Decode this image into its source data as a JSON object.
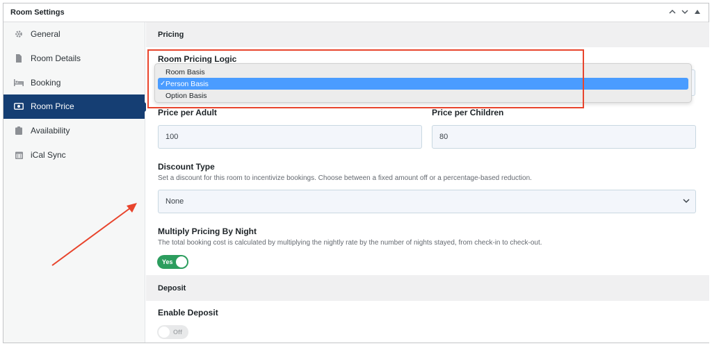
{
  "panel": {
    "title": "Room Settings",
    "collapse_up": "⌃",
    "collapse_down": "⌄",
    "move": "▴"
  },
  "sidebar": {
    "items": [
      {
        "label": "General",
        "icon": "gear-icon"
      },
      {
        "label": "Room Details",
        "icon": "document-icon"
      },
      {
        "label": "Booking",
        "icon": "bed-icon"
      },
      {
        "label": "Room Price",
        "icon": "money-icon",
        "active": true
      },
      {
        "label": "Availability",
        "icon": "clipboard-icon"
      },
      {
        "label": "iCal Sync",
        "icon": "calendar-icon"
      }
    ]
  },
  "pricing": {
    "section_title": "Pricing",
    "logic_label": "Room Pricing Logic",
    "logic_options": [
      "Room Basis",
      "Person Basis",
      "Option Basis"
    ],
    "logic_selected": "Person Basis",
    "adult_label": "Price per Adult",
    "adult_value": "100",
    "children_label": "Price per Children",
    "children_value": "80",
    "discount_label": "Discount Type",
    "discount_desc": "Set a discount for this room to incentivize bookings. Choose between a fixed amount off or a percentage-based reduction.",
    "discount_value": "None",
    "multiply_label": "Multiply Pricing By Night",
    "multiply_desc": "The total booking cost is calculated by multiplying the nightly rate by the number of nights stayed, from check-in to check-out.",
    "multiply_toggle": "Yes"
  },
  "deposit": {
    "section_title": "Deposit",
    "enable_label": "Enable Deposit",
    "enable_toggle": "Off"
  },
  "colors": {
    "active_nav": "#153e73",
    "toggle_on": "#2c9d5e",
    "highlight": "#e8442c",
    "dropdown_selected": "#4a9cff"
  }
}
